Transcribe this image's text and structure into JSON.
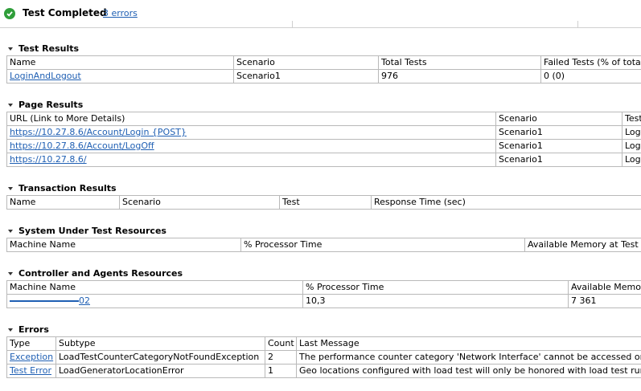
{
  "header": {
    "status": "Test Completed",
    "errors_link": "3 errors"
  },
  "test_results": {
    "title": "Test Results",
    "columns": [
      "Name",
      "Scenario",
      "Total Tests",
      "Failed Tests (% of total)"
    ],
    "rows": [
      [
        "LoginAndLogout",
        "Scenario1",
        "976",
        "0 (0)"
      ]
    ]
  },
  "page_results": {
    "title": "Page Results",
    "columns": [
      "URL (Link to More Details)",
      "Scenario",
      "Test"
    ],
    "rows": [
      [
        "https://10.27.8.6/Account/Login {POST}",
        "Scenario1",
        "Login"
      ],
      [
        "https://10.27.8.6/Account/LogOff",
        "Scenario1",
        "Login"
      ],
      [
        "https://10.27.8.6/",
        "Scenario1",
        "Login"
      ]
    ]
  },
  "transaction_results": {
    "title": "Transaction Results",
    "columns": [
      "Name",
      "Scenario",
      "Test",
      "Response Time (sec)"
    ]
  },
  "sut_resources": {
    "title": "System Under Test Resources",
    "columns": [
      "Machine Name",
      "% Processor Time",
      "Available Memory at Test Com"
    ]
  },
  "controller_resources": {
    "title": "Controller and Agents Resources",
    "columns": [
      "Machine Name",
      "% Processor Time",
      "Available Memory"
    ],
    "rows": [
      [
        "02",
        "10,3",
        "7 361"
      ]
    ]
  },
  "errors": {
    "title": "Errors",
    "columns": [
      "Type",
      "Subtype",
      "Count",
      "Last Message"
    ],
    "rows": [
      [
        "Exception",
        "LoadTestCounterCategoryNotFoundException",
        "2",
        "The performance counter category 'Network Interface' cannot be accessed on computer"
      ],
      [
        "Test Error",
        "LoadGeneratorLocationError",
        "1",
        "Geo locations configured with load test will only be honored with load test runs using Visu"
      ]
    ]
  },
  "colors": {
    "link": "#1f5fb3",
    "success": "#2f9e3a",
    "grid": "#b9b9b9"
  }
}
